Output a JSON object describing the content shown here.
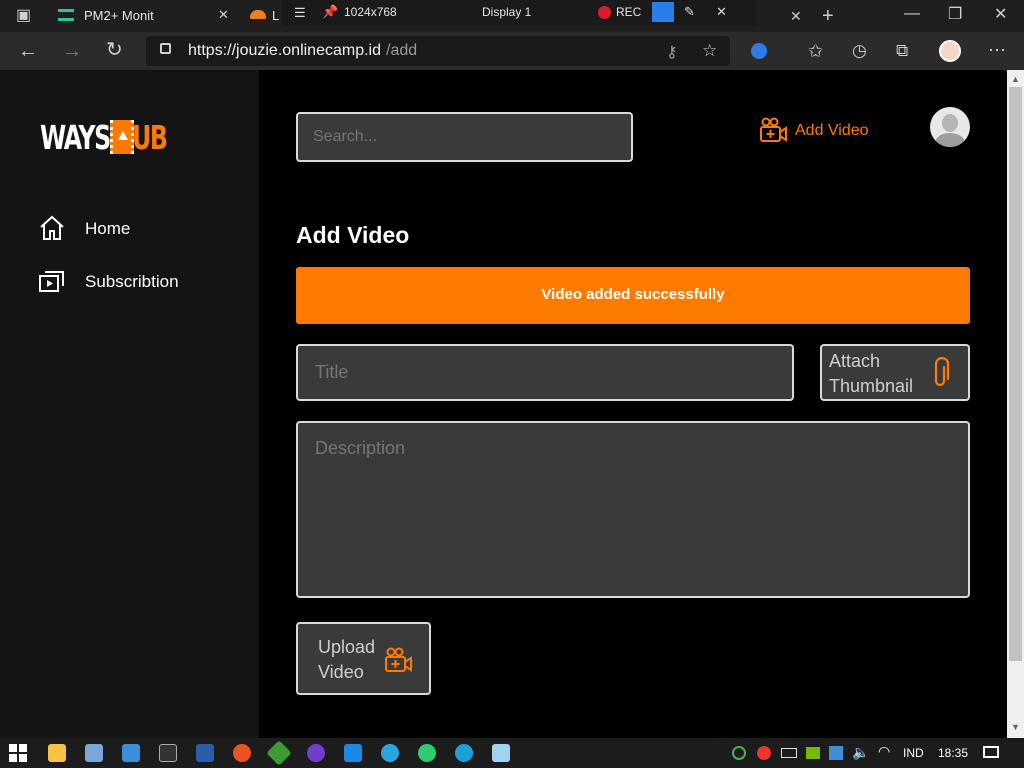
{
  "browser": {
    "tab1_title": "PM2+ Monit",
    "tab2_title": "L",
    "display_size": "1024x768",
    "display_name": "Display 1",
    "rec_label": "REC",
    "url_host": "https://jouzie.onlinecamp.id",
    "url_path": "/add"
  },
  "brand": {
    "logo_left": "WAYS",
    "logo_right": "UB"
  },
  "sidebar": {
    "items": [
      {
        "label": "Home",
        "icon": "home-icon"
      },
      {
        "label": "Subscribtion",
        "icon": "subscription-icon"
      }
    ]
  },
  "header": {
    "search_placeholder": "Search...",
    "add_video_label": "Add Video"
  },
  "form": {
    "heading": "Add Video",
    "alert": "Video added successfully",
    "title_placeholder": "Title",
    "attach_label": "Attach\nThumbnail",
    "description_placeholder": "Description",
    "upload_label": "Upload\nVideo"
  },
  "taskbar": {
    "language": "IND",
    "time": "18:35"
  },
  "colors": {
    "accent": "#ff7a00",
    "sidebar": "#141414",
    "field": "#3a3a3a"
  }
}
